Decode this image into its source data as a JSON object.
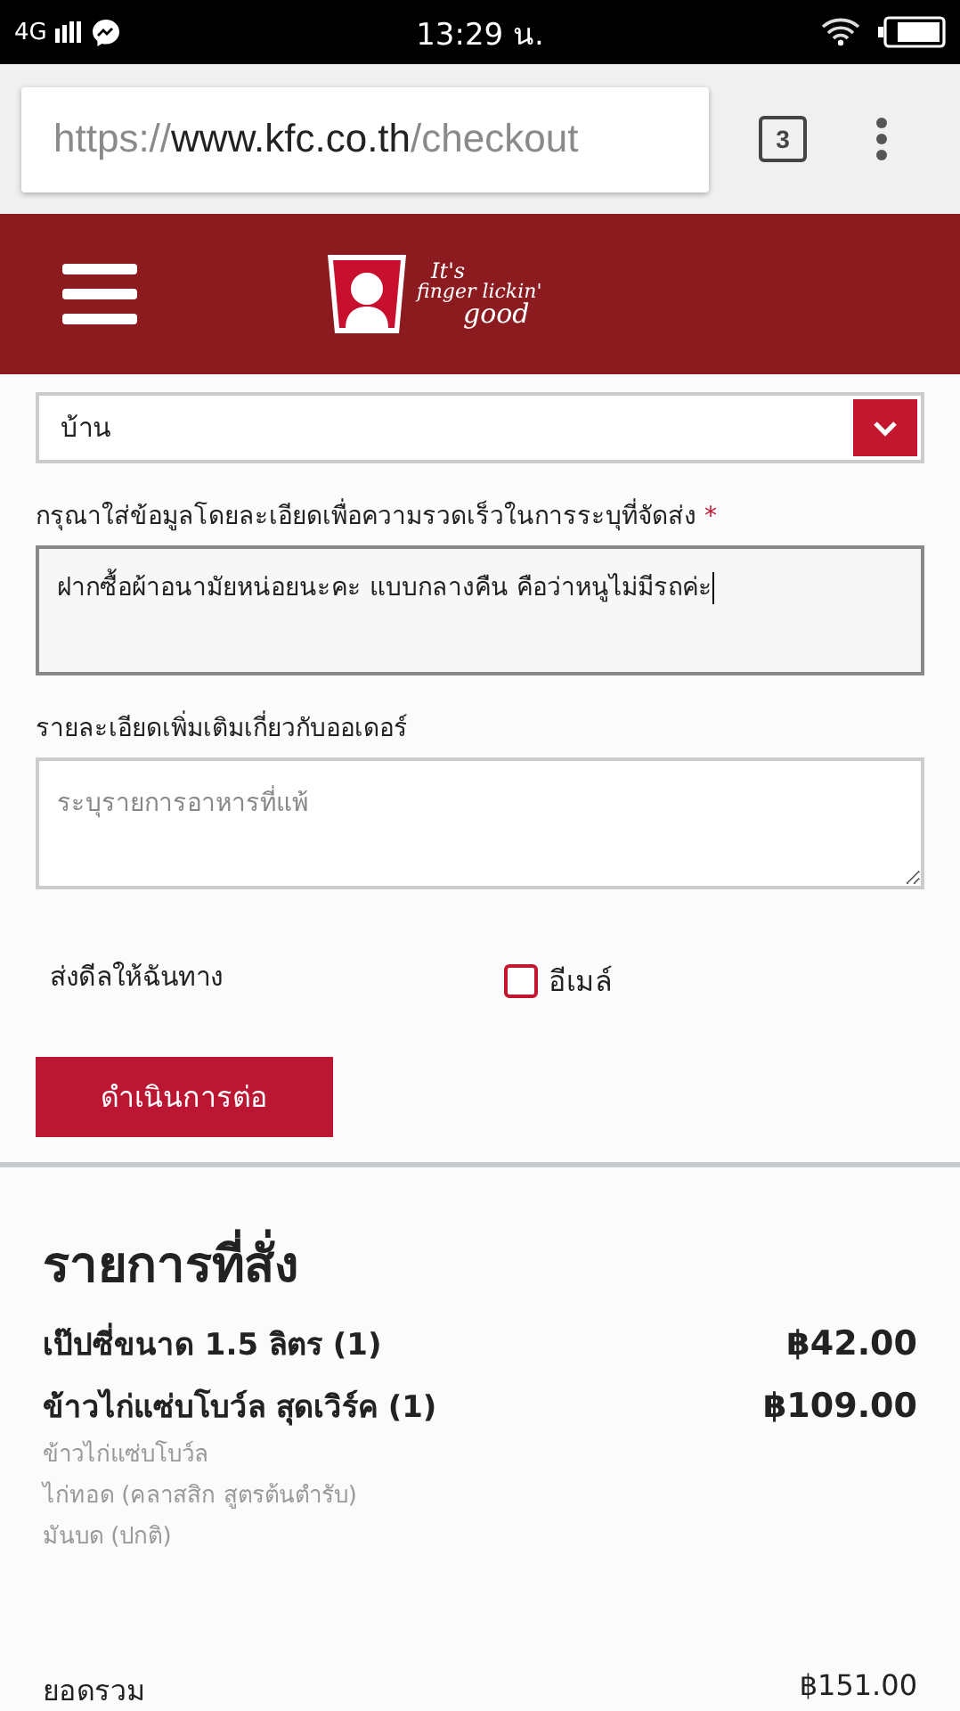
{
  "status_bar": {
    "network": "4G",
    "time": "13:29 น."
  },
  "browser": {
    "url": {
      "scheme": "https://",
      "host": "www.kfc.co.th",
      "path": "/checkout"
    },
    "tab_count": "3"
  },
  "header": {
    "slogan": [
      "It's",
      "finger lickin'",
      "good"
    ]
  },
  "form": {
    "address_type": {
      "value": "บ้าน"
    },
    "delivery_details": {
      "label": "กรุณาใส่ข้อมูลโดยละเอียดเพื่อความรวดเร็วในการระบุที่จัดส่ง",
      "required_mark": "*",
      "value": "ฝากซื้อผ้าอนามัยหน่อยนะคะ แบบกลางคืน คือว่าหนูไม่มีรถค่ะ"
    },
    "order_notes": {
      "label": "รายละเอียดเพิ่มเติมเกี่ยวกับออเดอร์",
      "placeholder": "ระบุรายการอาหารที่แพ้"
    },
    "deals": {
      "label": "ส่งดีลให้ฉันทาง",
      "options": [
        {
          "label": "อีเมล์",
          "checked": false
        }
      ]
    },
    "submit": "ดำเนินการต่อ"
  },
  "order": {
    "title": "รายการที่สั่ง",
    "items": [
      {
        "name": "เป๊ปซี่ขนาด 1.5 ลิตร (1)",
        "price": "฿42.00"
      },
      {
        "name": "ข้าวไก่แซ่บโบว์ล สุดเวิร์ค (1)",
        "price": "฿109.00",
        "details": [
          "ข้าวไก่แซ่บโบว์ล",
          "ไก่ทอด (คลาสสิก สูตรต้นตำรับ)",
          "มันบด (ปกติ)"
        ]
      }
    ],
    "total": {
      "label": "ยอดรวม",
      "value": "฿151.00"
    }
  }
}
